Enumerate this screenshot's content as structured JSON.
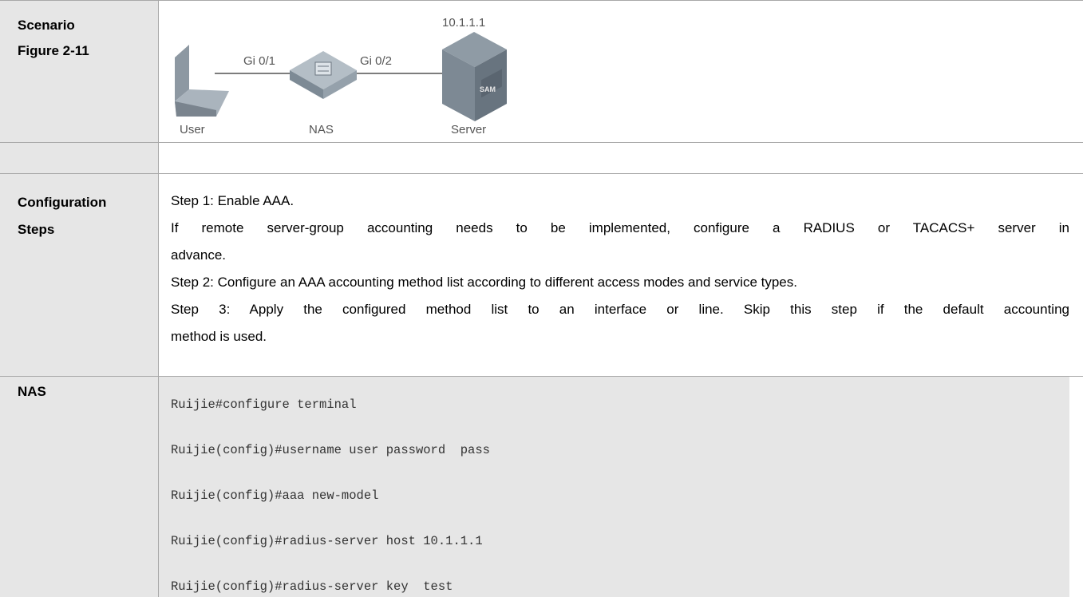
{
  "labels": {
    "scenario": "Scenario",
    "figure": "Figure 2-11",
    "config_steps_1": "Configuration",
    "config_steps_2": "Steps",
    "nas": "NAS"
  },
  "diagram": {
    "ip": "10.1.1.1",
    "port_left": "Gi 0/1",
    "port_right": "Gi 0/2",
    "user": "User",
    "nas": "NAS",
    "server": "Server",
    "server_badge": "SAM"
  },
  "steps": [
    "Step 1: Enable AAA.",
    "If remote server-group accounting needs to be implemented, configure a RADIUS or TACACS+ server in",
    "advance.",
    "Step 2: Configure an AAA accounting method list according to different access modes and service types.",
    "Step 3: Apply the configured method list to an interface or line. Skip this step if the default accounting",
    "method is used."
  ],
  "code": [
    "Ruijie#configure terminal",
    "Ruijie(config)#username user password  pass",
    "Ruijie(config)#aaa new-model",
    "Ruijie(config)#radius-server host 10.1.1.1",
    "Ruijie(config)#radius-server key  test"
  ]
}
